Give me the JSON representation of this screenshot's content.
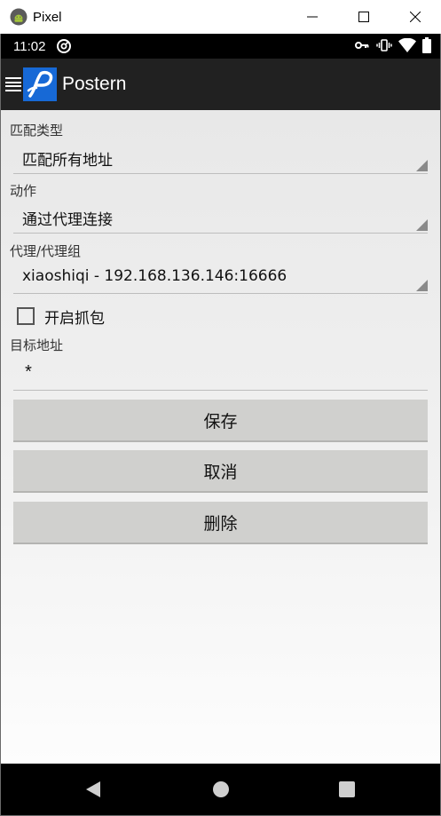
{
  "window": {
    "title": "Pixel",
    "icons": {
      "app": "android-icon",
      "minimize": "minimize-icon",
      "maximize": "maximize-icon",
      "close": "close-icon"
    }
  },
  "status_bar": {
    "time": "11:02",
    "icons": [
      "sync-icon",
      "vpn-key-icon",
      "vibrate-icon",
      "wifi-icon",
      "battery-icon"
    ]
  },
  "app_bar": {
    "logo_letter": "P",
    "title": "Postern",
    "logo_color": "#1769d6",
    "background": "#212121"
  },
  "form": {
    "match_type": {
      "label": "匹配类型",
      "value": "匹配所有地址"
    },
    "action": {
      "label": "动作",
      "value": "通过代理连接"
    },
    "proxy": {
      "label": "代理/代理组",
      "value": "xiaoshiqi - 192.168.136.146:16666"
    },
    "capture": {
      "label": "开启抓包",
      "checked": false
    },
    "target": {
      "label": "目标地址",
      "value": "*"
    }
  },
  "buttons": {
    "save": "保存",
    "cancel": "取消",
    "delete": "删除"
  },
  "nav_bar": {
    "icons": [
      "back-icon",
      "home-icon",
      "recents-icon"
    ]
  }
}
